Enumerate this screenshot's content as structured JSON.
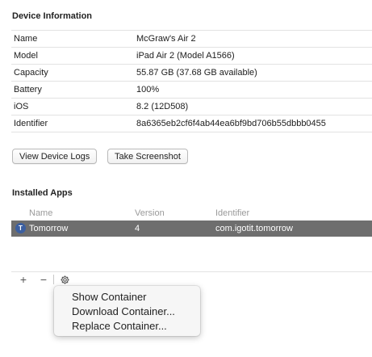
{
  "device_info": {
    "title": "Device Information",
    "rows": [
      {
        "key": "Name",
        "value": "McGraw's Air 2"
      },
      {
        "key": "Model",
        "value": "iPad Air 2 (Model A1566)"
      },
      {
        "key": "Capacity",
        "value": "55.87 GB (37.68 GB available)"
      },
      {
        "key": "Battery",
        "value": "100%"
      },
      {
        "key": "iOS",
        "value": "8.2 (12D508)"
      },
      {
        "key": "Identifier",
        "value": "8a6365eb2cf6f4ab44ea6bf9bd706b55dbbb0455"
      }
    ]
  },
  "buttons": {
    "view_logs": "View Device Logs",
    "screenshot": "Take Screenshot"
  },
  "installed_apps": {
    "title": "Installed Apps",
    "columns": [
      "Name",
      "Version",
      "Identifier"
    ],
    "rows": [
      {
        "icon_letter": "T",
        "name": "Tomorrow",
        "version": "4",
        "identifier": "com.igotit.tomorrow"
      }
    ]
  },
  "toolbar": {
    "add": "+",
    "remove": "−",
    "gear_icon": "gear-icon"
  },
  "context_menu": {
    "items": [
      "Show Container",
      "Download Container...",
      "Replace Container..."
    ]
  },
  "colors": {
    "selected_row": "#6e6e6e",
    "app_icon": "#3c5fa0"
  }
}
